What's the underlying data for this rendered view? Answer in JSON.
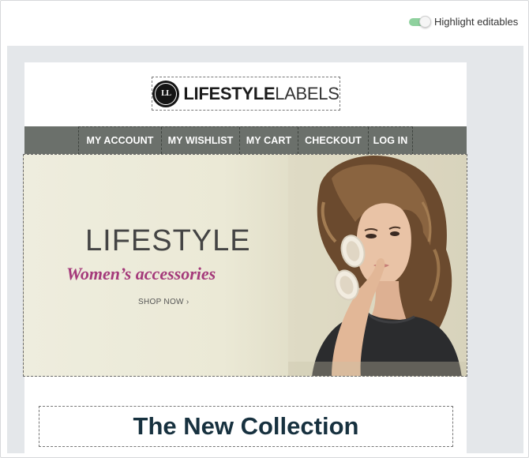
{
  "toolbar": {
    "highlight_label": "Highlight editables",
    "highlight_enabled": true,
    "toggle_color": "#8fd19e"
  },
  "logo": {
    "badge_text": "LL",
    "brand_bold": "LIFESTYLE",
    "brand_light": "LABELS"
  },
  "nav": {
    "items": [
      {
        "label": "MY ACCOUNT"
      },
      {
        "label": "MY WISHLIST"
      },
      {
        "label": "MY CART"
      },
      {
        "label": "CHECKOUT"
      },
      {
        "label": "LOG IN"
      }
    ],
    "background": "#6b706b"
  },
  "hero": {
    "title": "LIFESTYLE",
    "subtitle": "Women’s accessories",
    "cta": "SHOP NOW  ›",
    "accent_color": "#a4397a"
  },
  "section": {
    "heading": "The New Collection"
  }
}
